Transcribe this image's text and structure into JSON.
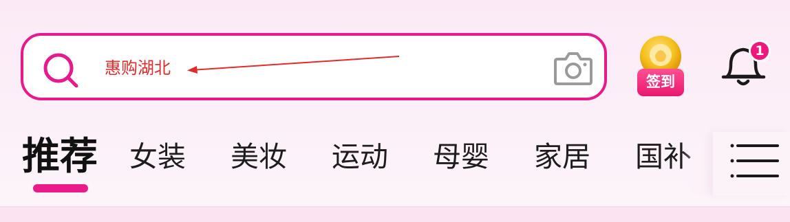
{
  "search": {
    "placeholder": "惠购湖北",
    "search_icon": "search-icon",
    "camera_icon": "camera-icon"
  },
  "signin": {
    "label": "签到",
    "icon": "coin-icon"
  },
  "notifications": {
    "icon": "bell-icon",
    "badge_count": "1"
  },
  "tabs": [
    {
      "label": "推荐",
      "active": true
    },
    {
      "label": "女装",
      "active": false
    },
    {
      "label": "美妆",
      "active": false
    },
    {
      "label": "运动",
      "active": false
    },
    {
      "label": "母婴",
      "active": false
    },
    {
      "label": "家居",
      "active": false
    },
    {
      "label": "国补",
      "active": false
    }
  ],
  "menu": {
    "icon": "menu-icon"
  },
  "colors": {
    "accent": "#e8188e",
    "annotation": "#e52a2a",
    "badge": "#f0187f",
    "text": "#1d1d1d"
  }
}
